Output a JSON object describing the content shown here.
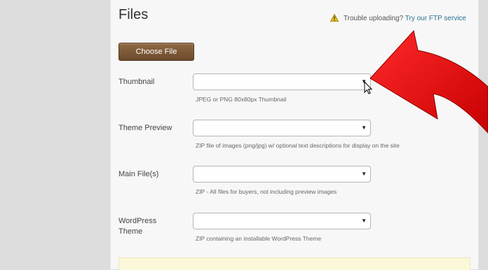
{
  "page": {
    "title": "Files",
    "trouble_text": "Trouble uploading?",
    "trouble_link": "Try our FTP service"
  },
  "upload": {
    "choose_label": "Choose File"
  },
  "fields": [
    {
      "label": "Thumbnail",
      "hint": "JPEG or PNG 80x80px Thumbnail"
    },
    {
      "label": "Theme Preview",
      "hint": "ZIP file of images (png/jpg) w/ optional text descriptions for display on the site"
    },
    {
      "label": "Main File(s)",
      "hint": "ZIP - All files for buyers, not including preview images"
    },
    {
      "label_line1": "WordPress",
      "label_line2": "Theme",
      "hint": "ZIP containing an installable WordPress Theme"
    }
  ],
  "colors": {
    "annotation_arrow": "#e00000",
    "button": "#7a5633",
    "link": "#2a6f92"
  }
}
